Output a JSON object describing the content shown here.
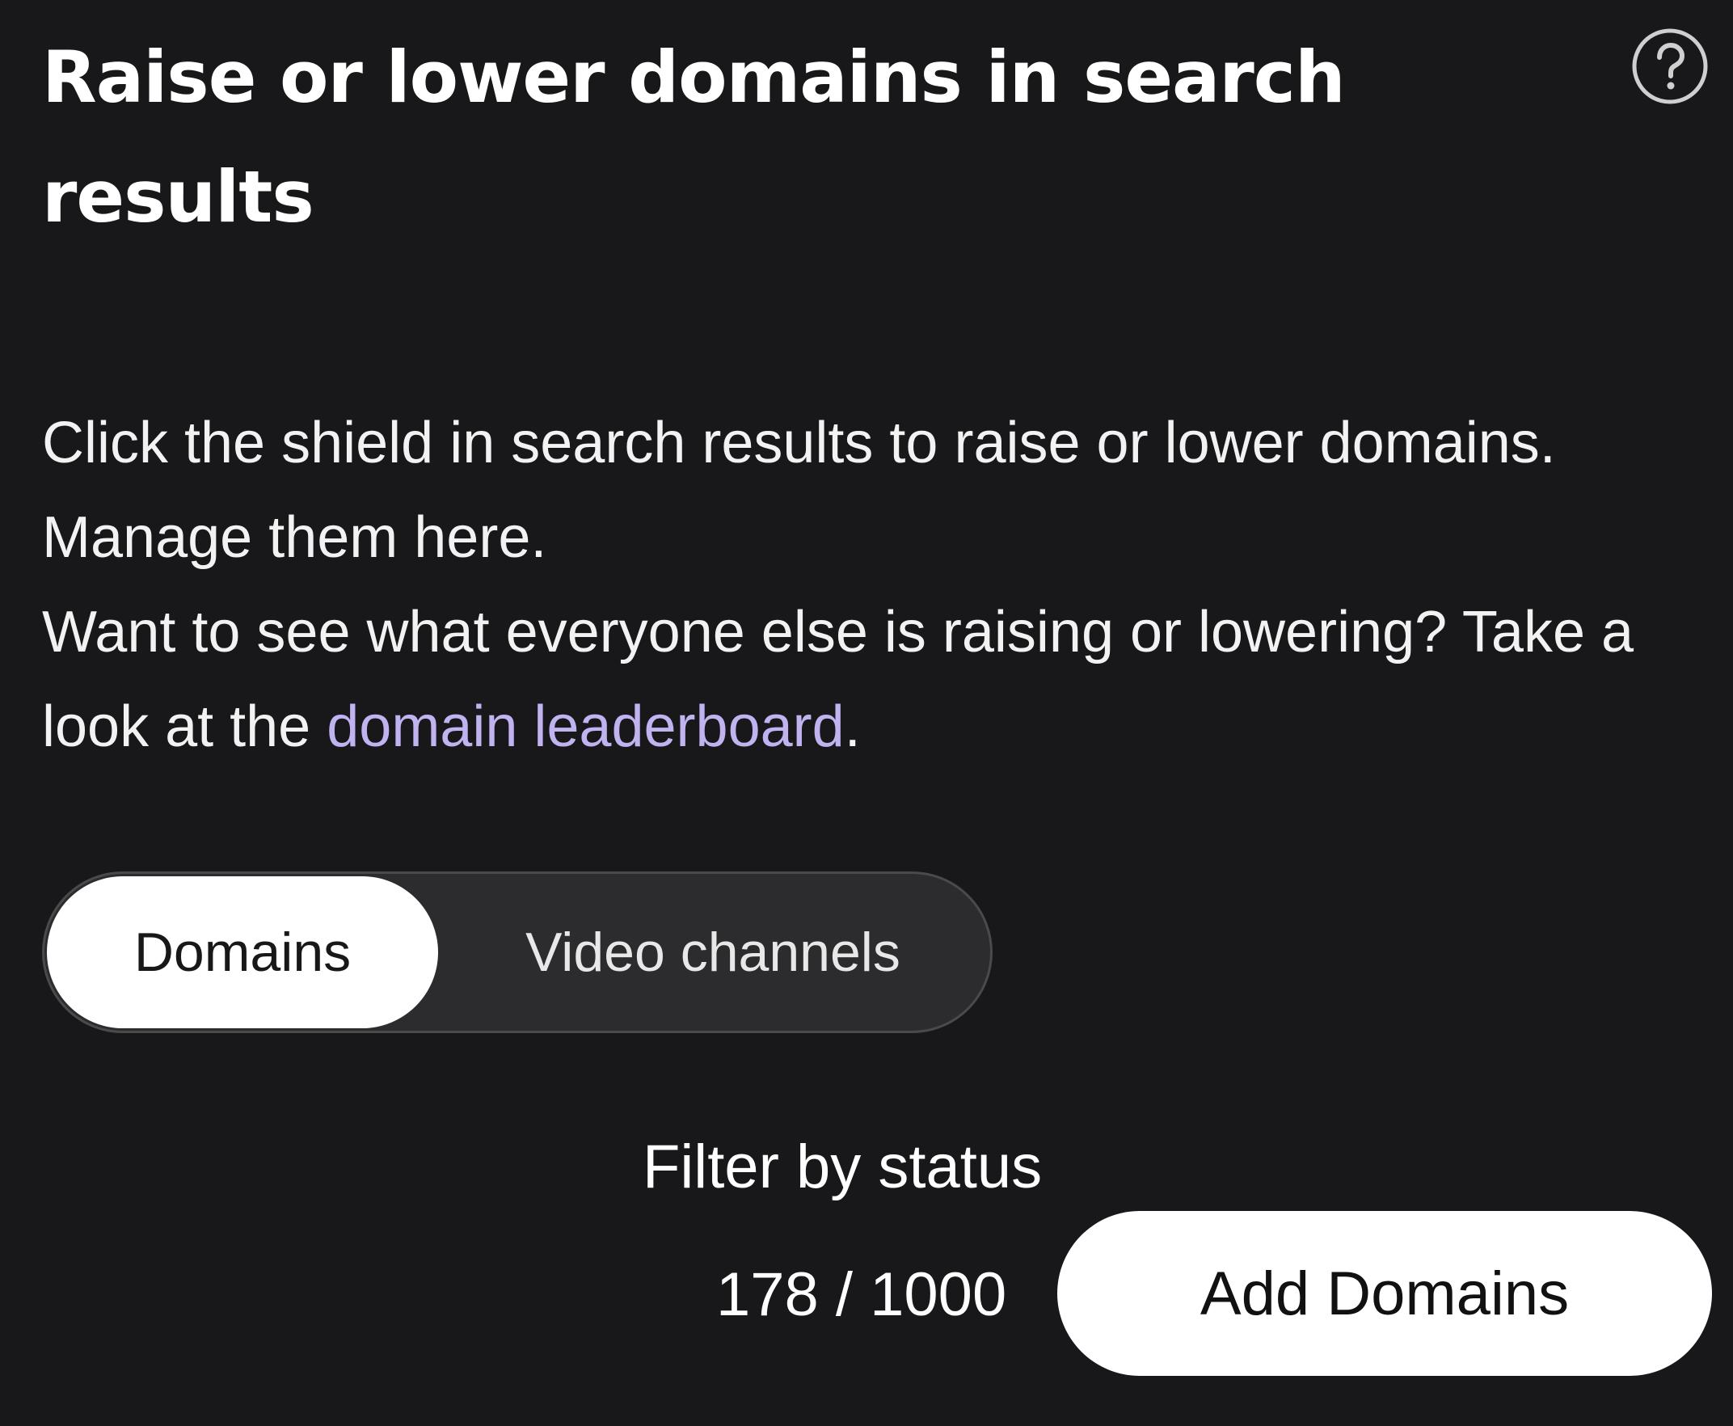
{
  "header": {
    "title": "Raise or lower domains in search results",
    "help_icon": "question-circle-icon"
  },
  "description": {
    "line1": "Click the shield in search results to raise or lower domains. Manage them here.",
    "line2_prefix": "Want to see what everyone else is raising or lowering? Take a look at the ",
    "link_text": "domain leaderboard",
    "line2_suffix": "."
  },
  "tabs": [
    {
      "label": "Domains",
      "active": true
    },
    {
      "label": "Video channels",
      "active": false
    }
  ],
  "filter": {
    "label": "Filter by status"
  },
  "footer": {
    "count": "178 / 1000",
    "add_button_label": "Add Domains"
  },
  "colors": {
    "background": "#18181a",
    "link": "#c0b3f0",
    "active_tab_bg": "#ffffff",
    "inactive_tab_bg": "#2c2c2e"
  }
}
